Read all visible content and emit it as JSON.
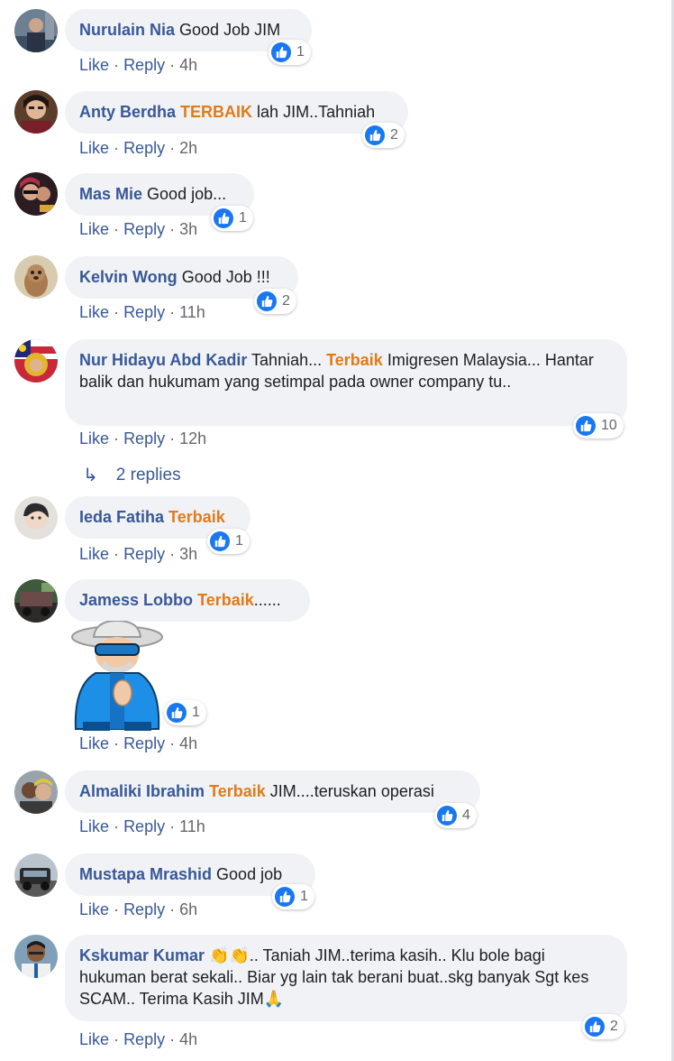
{
  "comments": [
    {
      "name": "Nurulain Nia",
      "pre": "",
      "hl": "",
      "text": "Good Job JIM",
      "like": "Like",
      "reply": "Reply",
      "sep": "·",
      "time": "4h",
      "reactions": "1"
    },
    {
      "name": "Anty Berdha",
      "pre": "",
      "hl": "TERBAIK",
      "text": "lah JIM..Tahniah",
      "like": "Like",
      "reply": "Reply",
      "sep": "·",
      "time": "2h",
      "reactions": "2"
    },
    {
      "name": "Mas Mie",
      "pre": "",
      "hl": "",
      "text": "Good job...",
      "like": "Like",
      "reply": "Reply",
      "sep": "·",
      "time": "3h",
      "reactions": "1"
    },
    {
      "name": "Kelvin Wong",
      "pre": "",
      "hl": "",
      "text": "Good Job !!!",
      "like": "Like",
      "reply": "Reply",
      "sep": "·",
      "time": "11h",
      "reactions": "2"
    },
    {
      "name": "Nur Hidayu Abd Kadir",
      "pre": "Tahniah...",
      "hl": "Terbaik",
      "text": "Imigresen Malaysia... Hantar balik dan hukumam yang setimpal pada owner company tu..",
      "like": "Like",
      "reply": "Reply",
      "sep": "·",
      "time": "12h",
      "reactions": "10",
      "replies_label": "2 replies"
    },
    {
      "name": "Ieda Fatiha",
      "pre": "",
      "hl": "Terbaik",
      "text": "",
      "like": "Like",
      "reply": "Reply",
      "sep": "·",
      "time": "3h",
      "reactions": "1"
    },
    {
      "name": "Jamess Lobbo",
      "pre": "",
      "hl": "Terbaik",
      "text": "......",
      "like": "Like",
      "reply": "Reply",
      "sep": "·",
      "time": "4h",
      "reactions": "1"
    },
    {
      "name": "Almaliki Ibrahim",
      "pre": "",
      "hl": "Terbaik",
      "text": "JIM....teruskan operasi",
      "like": "Like",
      "reply": "Reply",
      "sep": "·",
      "time": "11h",
      "reactions": "4"
    },
    {
      "name": "Mustapa Mrashid",
      "pre": "",
      "hl": "",
      "text": "Good job",
      "like": "Like",
      "reply": "Reply",
      "sep": "·",
      "time": "6h",
      "reactions": "1"
    },
    {
      "name": "Kskumar Kumar",
      "pre": "👏👏",
      "hl": "",
      "text": ".. Taniah JIM..terima kasih.. Klu bole bagi hukuman berat sekali.. Biar yg lain tak berani buat..skg banyak Sgt kes SCAM.. Terima Kasih JIM🙏",
      "like": "Like",
      "reply": "Reply",
      "sep": "·",
      "time": "4h",
      "reactions": "2"
    }
  ],
  "colors": {
    "name": "#385898",
    "highlight": "#e07b1a",
    "bubble": "#f0f2f5",
    "like_badge": "#1877f2",
    "meta": "#65676b"
  },
  "icons": {
    "reaction": "thumbs-up-icon",
    "reply_arrow": "reply-arrow-icon"
  }
}
